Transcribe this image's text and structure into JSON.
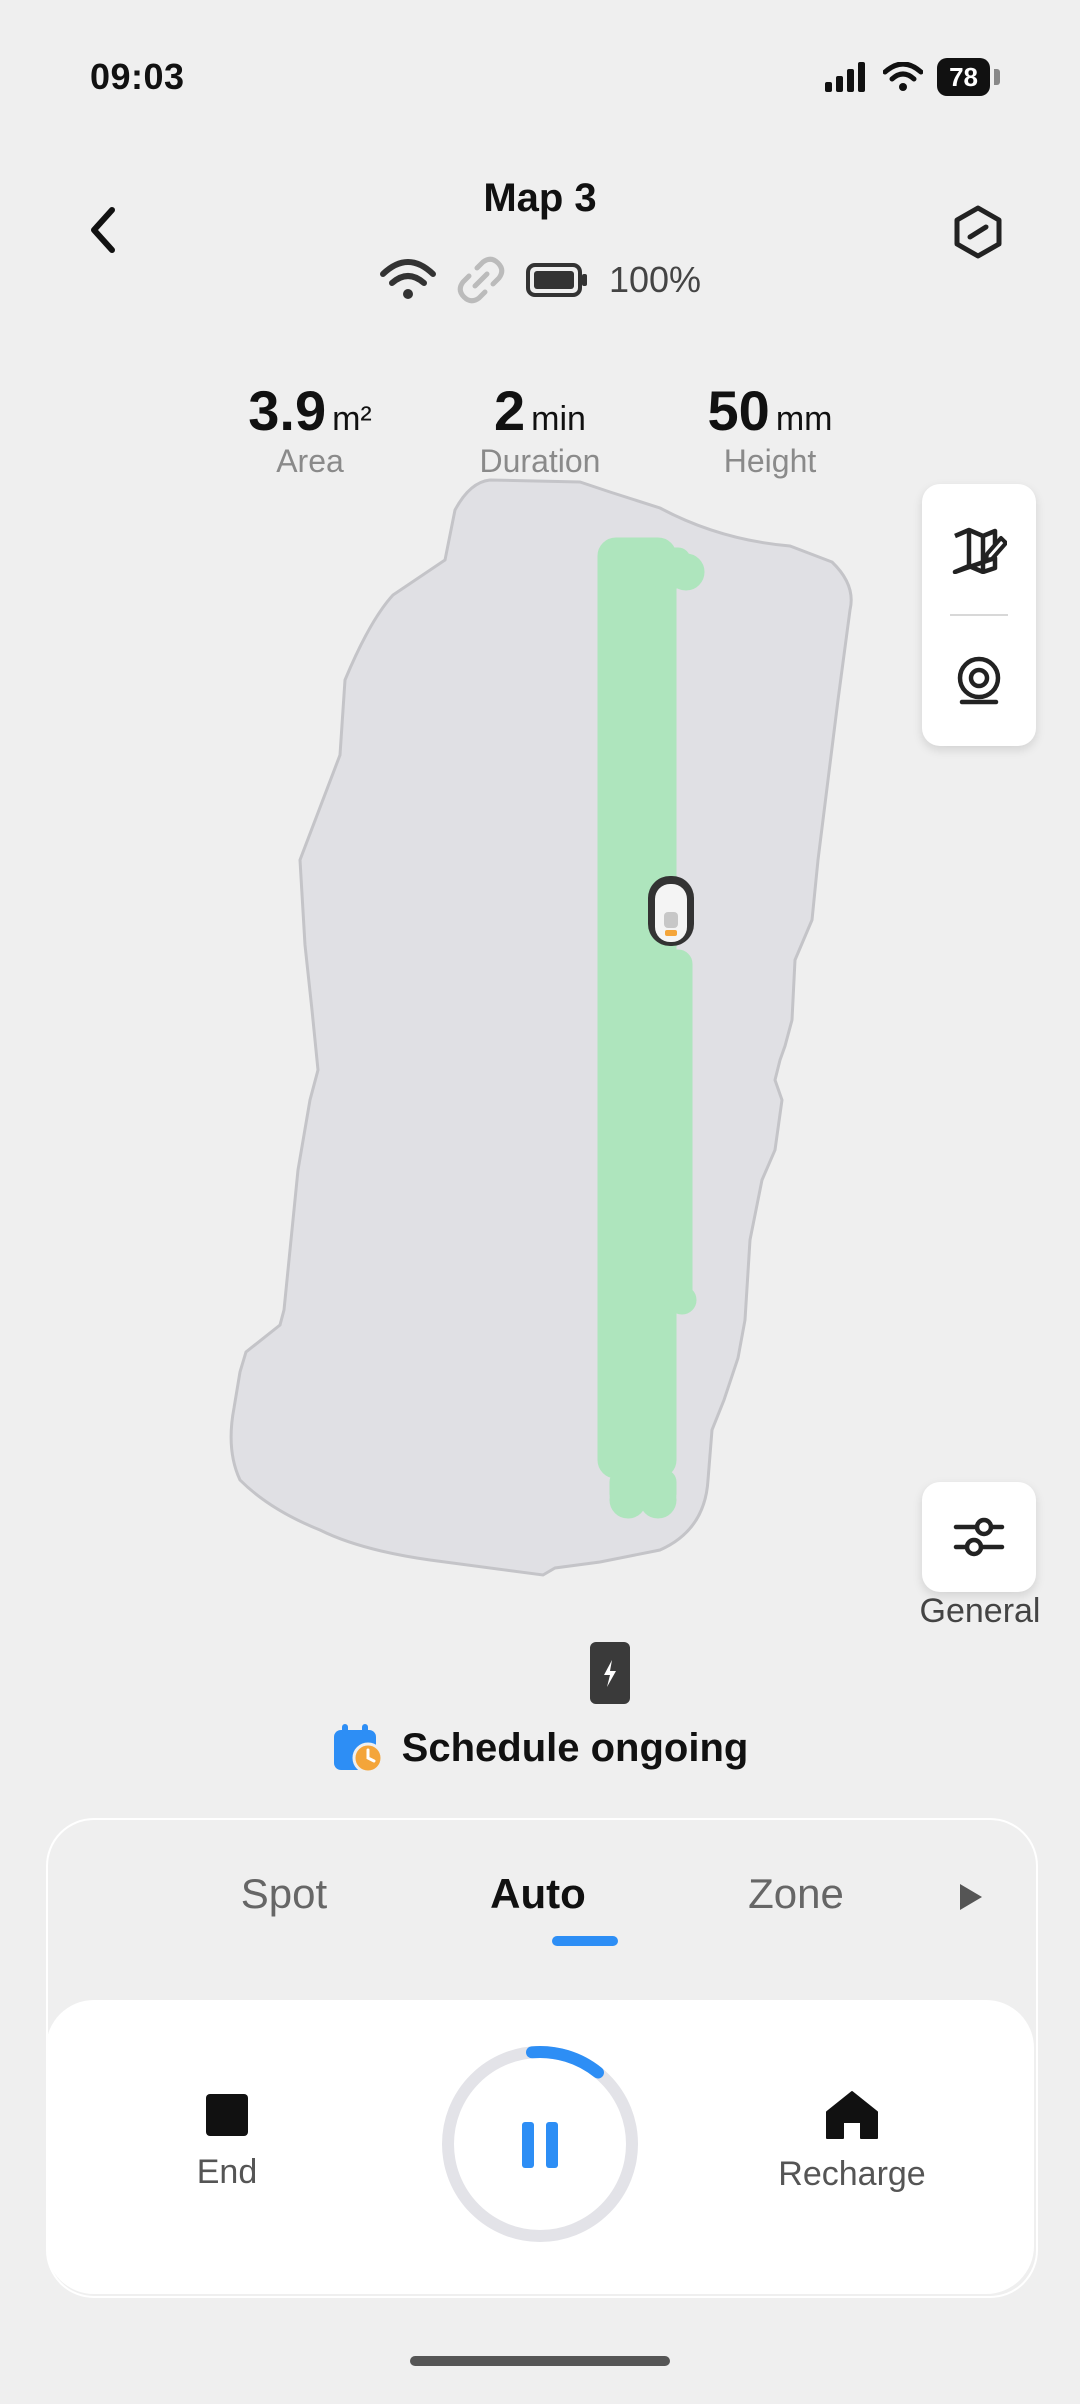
{
  "status_bar": {
    "time": "09:03",
    "battery": "78"
  },
  "header": {
    "title": "Map 3",
    "battery_pct": "100%"
  },
  "stats": [
    {
      "value": "3.9",
      "unit": "m²",
      "label": "Area"
    },
    {
      "value": "2",
      "unit": "min",
      "label": "Duration"
    },
    {
      "value": "50",
      "unit": "mm",
      "label": "Height"
    }
  ],
  "general": {
    "label": "General"
  },
  "schedule": {
    "text": "Schedule ongoing"
  },
  "tabs": [
    {
      "label": "Spot",
      "active": false
    },
    {
      "label": "Auto",
      "active": true
    },
    {
      "label": "Zone",
      "active": false
    }
  ],
  "actions": {
    "end": "End",
    "recharge": "Recharge"
  },
  "colors": {
    "accent": "#2d8ef5",
    "mowed": "#aee5bd",
    "lawn": "#e0e0e4",
    "schedule_icon": "#2d8ef5",
    "clock_badge": "#f4a53a"
  }
}
